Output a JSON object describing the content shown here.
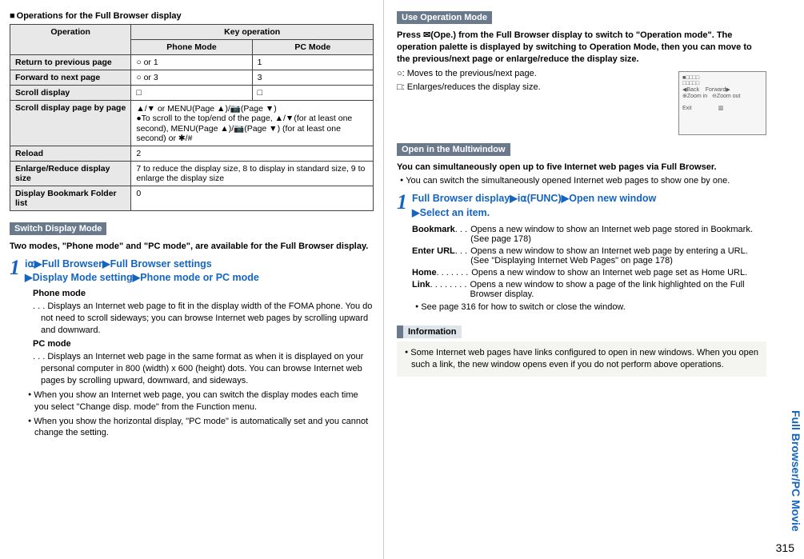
{
  "left": {
    "section_title": "Operations for the Full Browser display",
    "table": {
      "col_op": "Operation",
      "col_key": "Key operation",
      "col_phone": "Phone Mode",
      "col_pc": "PC Mode",
      "rows": {
        "r1": {
          "op": "Return to previous page",
          "phone": "○ or 1",
          "pc": "1"
        },
        "r2": {
          "op": "Forward to next page",
          "phone": "○ or 3",
          "pc": "3"
        },
        "r3": {
          "op": "Scroll display",
          "phone": "□",
          "pc": "□"
        },
        "r4": {
          "op": "Scroll display page by page",
          "merged": "▲/▼ or MENU(Page ▲)/📷(Page ▼)\n●To scroll to the top/end of the page, ▲/▼(for at least one second), MENU(Page ▲)/📷(Page ▼) (for at least one second) or ✱/#"
        },
        "r5": {
          "op": "Reload",
          "merged": "2"
        },
        "r6": {
          "op": "Enlarge/Reduce display size",
          "merged": "7 to reduce the display size, 8 to display in standard size, 9 to enlarge the display size"
        },
        "r7": {
          "op": "Display Bookmark Folder list",
          "merged": "0"
        }
      }
    },
    "switch_title": "Switch Display Mode",
    "switch_intro": "Two modes, \"Phone mode\" and \"PC mode\", are available for the Full Browser display.",
    "step1_line1": "i⍺▶Full Browser▶Full Browser settings",
    "step1_line2": "▶Display Mode setting▶Phone mode or PC mode",
    "phone_mode_label": "Phone mode",
    "phone_mode_desc": " . . . Displays an Internet web page to fit in the display width of the FOMA phone. You do not need to scroll sideways; you can browse Internet web pages by scrolling upward and downward.",
    "pc_mode_label": "PC mode",
    "pc_mode_desc": " . . . Displays an Internet web page in the same format as when it is displayed on your personal computer in 800 (width) x 600 (height) dots. You can browse Internet web pages by scrolling upward, downward, and sideways.",
    "bullet1": "When you show an Internet web page, you can switch the display modes each time you select \"Change disp. mode\" from the Function menu.",
    "bullet2": "When you show the horizontal display, \"PC mode\" is automatically set and you cannot change the setting."
  },
  "right": {
    "use_title": "Use Operation Mode",
    "use_intro": "Press ✉(Ope.) from the Full Browser display to switch to \"Operation mode\". The operation palette is displayed by switching to Operation Mode, then you can move to the previous/next page or enlarge/reduce the display size.",
    "use_k1": "○: Moves to the previous/next page.",
    "use_k2": "□: Enlarges/reduces the display size.",
    "open_title": "Open in the Multiwindow",
    "open_intro": "You can simultaneously open up to five Internet web pages via Full Browser.",
    "open_bullet": "You can switch the simultaneously opened Internet web pages to show one by one.",
    "step1_line1": "Full Browser display▶i⍺(FUNC)▶Open new window",
    "step1_line2": "▶Select an item.",
    "defs": {
      "bookmark": {
        "label": "Bookmark",
        "dots": " . . . ",
        "desc": "Opens a new window to show an Internet web page stored in Bookmark. (See page 178)"
      },
      "enterurl": {
        "label": "Enter URL",
        "dots": " . . . ",
        "desc": "Opens a new window to show an Internet web page by entering a URL. (See \"Displaying Internet Web Pages\" on page 178)"
      },
      "home": {
        "label": "Home",
        "dots": " . . . . . . . ",
        "desc": "Opens a new window to show an Internet web page set as Home URL."
      },
      "link": {
        "label": "Link",
        "dots": "  . . . . . . . . ",
        "desc": "Opens a new window to show a page of the link highlighted on the Full Browser display."
      }
    },
    "see_page": "See page 316 for how to switch or close the window.",
    "info_title": "Information",
    "info_text": "Some Internet web pages have links configured to open in new windows. When you open such a link, the new window opens even if you do not perform above operations."
  },
  "side_tab": "Full Browser/PC Movie",
  "page_num": "315"
}
